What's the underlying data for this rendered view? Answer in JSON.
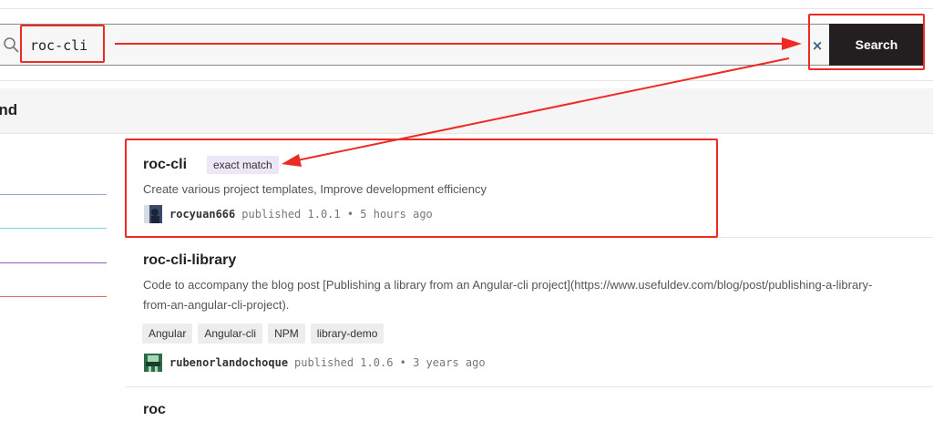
{
  "search": {
    "value": "roc-cli",
    "clear_icon": "×",
    "button_label": "Search"
  },
  "results_heading": "und",
  "filter_lines": [
    "#9aa3c8",
    "#7fd3e0",
    "#8a5cc7",
    "#e06a6a"
  ],
  "results": [
    {
      "name": "roc-cli",
      "badge": "exact match",
      "description": "Create various project templates, Improve development efficiency",
      "publisher": "rocyuan666",
      "published": "published 1.0.1 • 5 hours ago"
    },
    {
      "name": "roc-cli-library",
      "description_line1": "Code to accompany the blog post [Publishing a library from an Angular-cli project](https://www.usefuldev.com/blog/post/publishing-a-library-",
      "description_line2": "from-an-angular-cli-project).",
      "tags": [
        "Angular",
        "Angular-cli",
        "NPM",
        "library-demo"
      ],
      "publisher": "rubenorlandochoque",
      "published": "published 1.0.6 • 3 years ago"
    },
    {
      "name": "roc"
    }
  ],
  "colors": {
    "annotation": "#ee2a24",
    "search_button": "#231f20",
    "badge_bg": "#ece6f7"
  }
}
